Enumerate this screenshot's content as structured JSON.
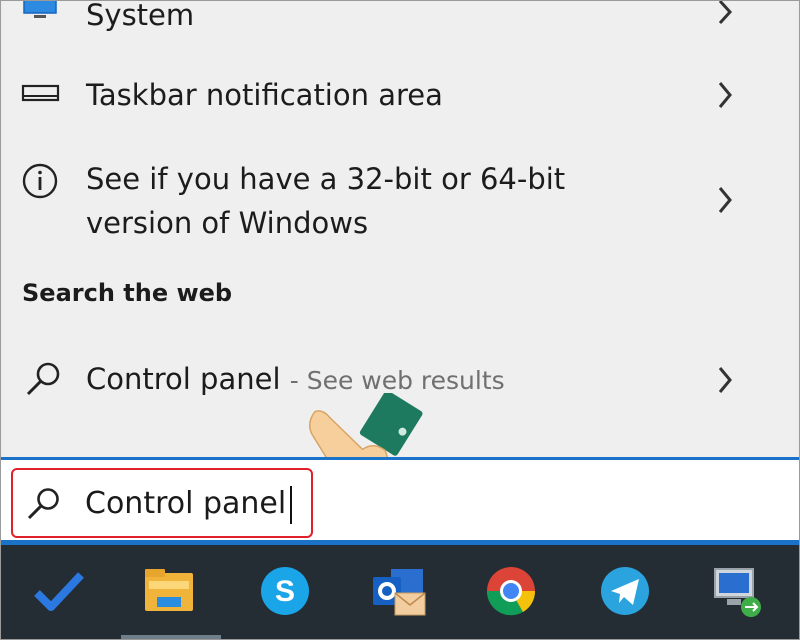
{
  "results": [
    {
      "label": "System",
      "icon": "monitor-icon"
    },
    {
      "label": "Taskbar notification area",
      "icon": "taskbar-icon"
    },
    {
      "label_line1": "See if you have a 32-bit or 64-bit",
      "label_line2": "version of Windows",
      "icon": "info-icon"
    }
  ],
  "web_section": {
    "title": "Search the web",
    "query": "Control panel",
    "suffix": "- See web results",
    "icon": "search-icon"
  },
  "search": {
    "value": "Control panel",
    "icon": "search-icon"
  },
  "taskbar": {
    "apps": [
      "checkmark-app-icon",
      "file-explorer-icon",
      "skype-icon",
      "outlook-icon",
      "chrome-icon",
      "telegram-icon",
      "remote-desktop-icon"
    ]
  },
  "colors": {
    "accent": "#1a73c8",
    "highlight": "#e0202a",
    "taskbar": "#242d33"
  }
}
